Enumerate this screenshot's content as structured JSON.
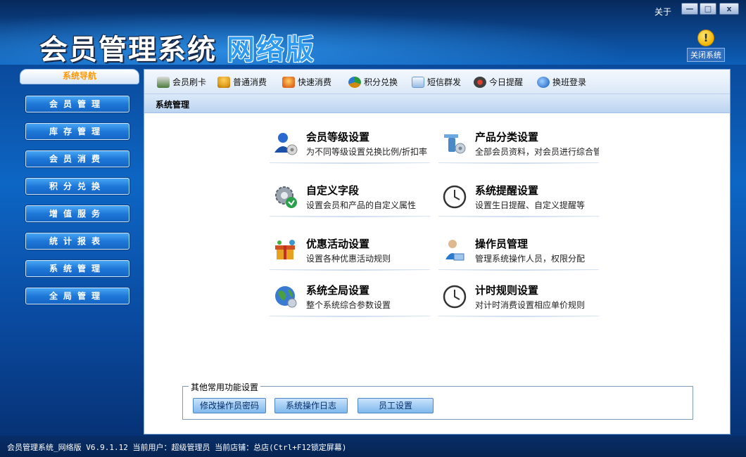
{
  "window": {
    "title_main": "会员管理系统",
    "title_edition": "网络版",
    "about": "关于",
    "minimize": "—",
    "maximize": "□",
    "close": "x",
    "close_system": "关闭系统"
  },
  "nav": {
    "header": "系统导航",
    "items": [
      {
        "label": "会员管理"
      },
      {
        "label": "库存管理"
      },
      {
        "label": "会员消费"
      },
      {
        "label": "积分兑换"
      },
      {
        "label": "增值服务"
      },
      {
        "label": "统计报表"
      },
      {
        "label": "系统管理"
      },
      {
        "label": "全局管理"
      }
    ]
  },
  "toolbar": {
    "items": [
      {
        "label": "会员刷卡",
        "icon": "card-reader-icon",
        "color": "#4a7a3a"
      },
      {
        "label": "普通消费",
        "icon": "person-money-icon",
        "color": "#e0a020"
      },
      {
        "label": "快速消费",
        "icon": "fast-consume-icon",
        "color": "#e06a20"
      },
      {
        "label": "积分兑换",
        "icon": "exchange-icon",
        "color": "#d08a10"
      },
      {
        "label": "短信群发",
        "icon": "envelope-icon",
        "color": "#6a9ad0"
      },
      {
        "label": "今日提醒",
        "icon": "alarm-icon",
        "color": "#404040"
      },
      {
        "label": "换班登录",
        "icon": "shift-login-icon",
        "color": "#3a7ad0"
      }
    ]
  },
  "section": {
    "title": "系统管理"
  },
  "functions": [
    {
      "title": "会员等级设置",
      "desc": "为不同等级设置兑换比例/折扣率",
      "icon": "member-level-icon"
    },
    {
      "title": "产品分类设置",
      "desc": "全部会员资料，对会员进行综合管理",
      "icon": "product-category-icon"
    },
    {
      "title": "自定义字段",
      "desc": "设置会员和产品的自定义属性",
      "icon": "custom-field-icon"
    },
    {
      "title": "系统提醒设置",
      "desc": "设置生日提醒、自定义提醒等",
      "icon": "clock-icon"
    },
    {
      "title": "优惠活动设置",
      "desc": "设置各种优惠活动规则",
      "icon": "gift-icon"
    },
    {
      "title": "操作员管理",
      "desc": "管理系统操作人员，权限分配",
      "icon": "operator-icon"
    },
    {
      "title": "系统全局设置",
      "desc": "整个系统综合参数设置",
      "icon": "globe-icon"
    },
    {
      "title": "计时规则设置",
      "desc": "对计时消费设置相应单价规则",
      "icon": "timer-clock-icon"
    }
  ],
  "other": {
    "legend": "其他常用功能设置",
    "buttons": [
      {
        "label": "修改操作员密码"
      },
      {
        "label": "系统操作日志"
      },
      {
        "label": "员工设置"
      }
    ]
  },
  "status": {
    "text": "会员管理系统_网络版 V6.9.1.12 当前用户：超级管理员 当前店铺：总店(Ctrl+F12锁定屏幕)"
  }
}
